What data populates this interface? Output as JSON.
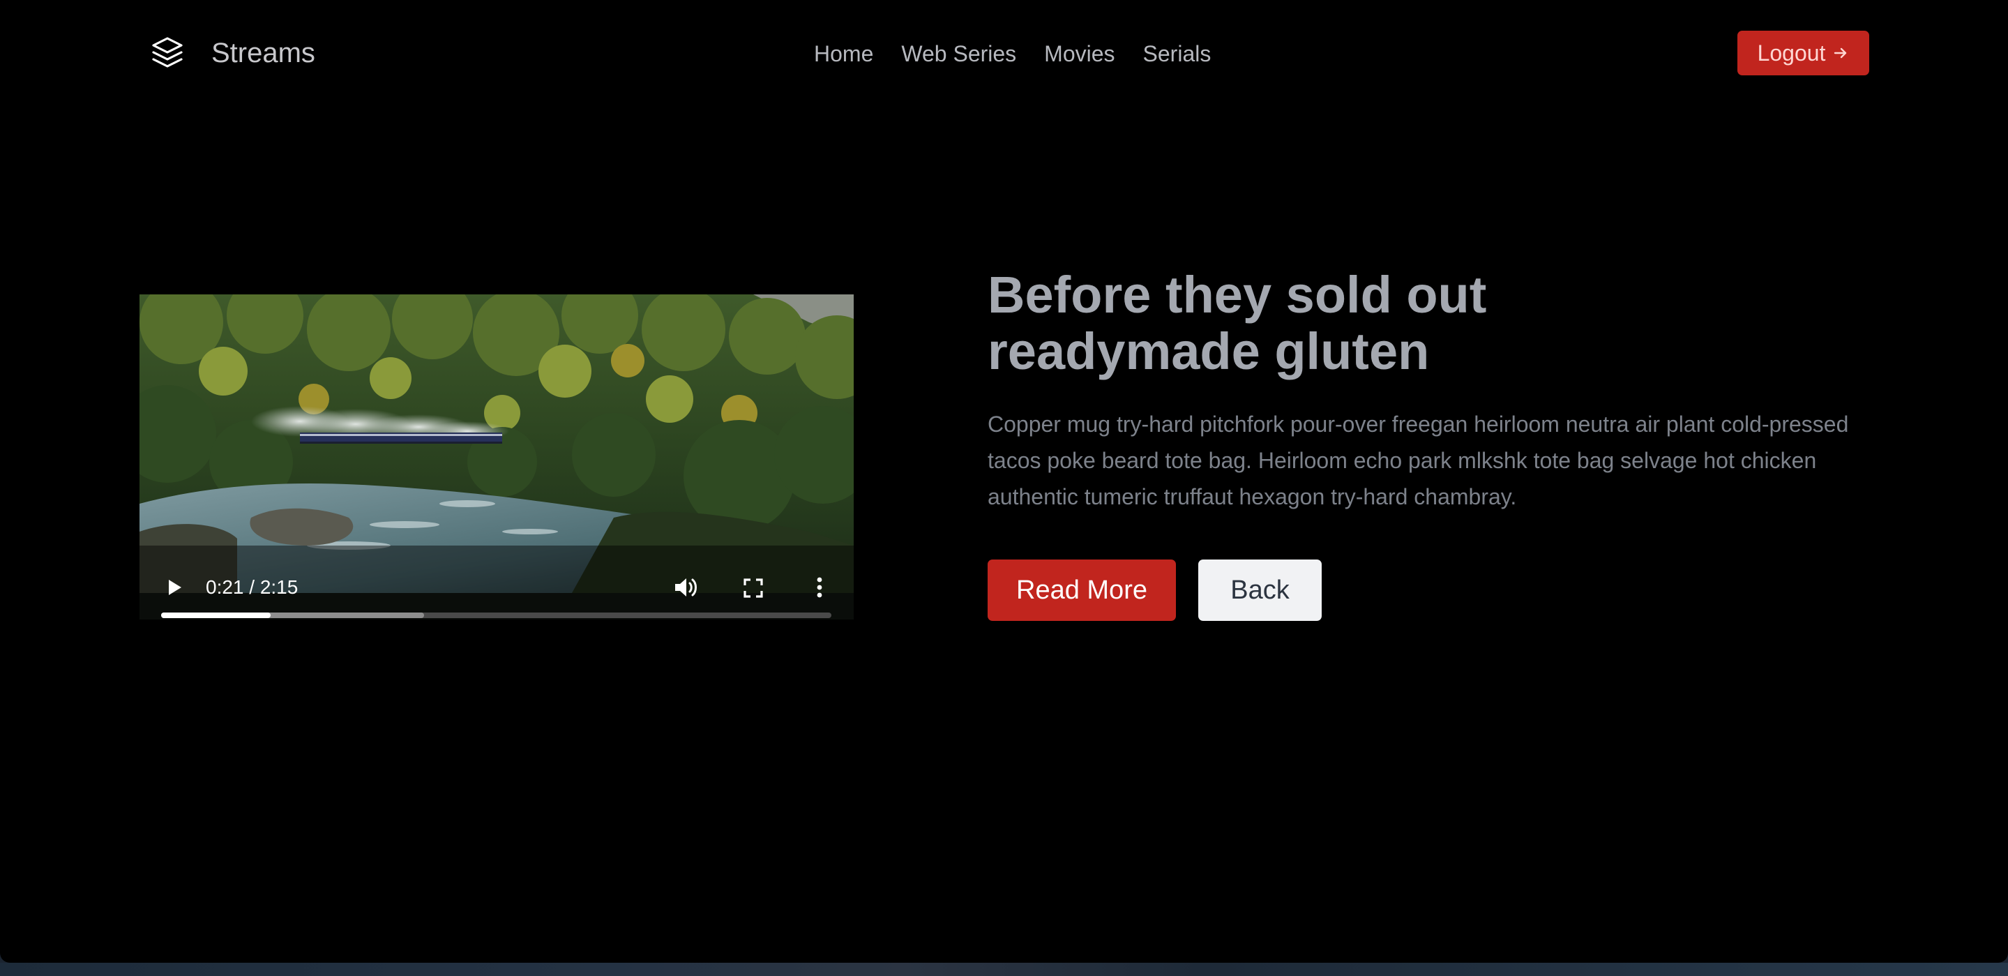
{
  "header": {
    "brand": "Streams",
    "nav": [
      "Home",
      "Web Series",
      "Movies",
      "Serials"
    ],
    "logout_label": "Logout"
  },
  "video": {
    "current_time": "0:21",
    "duration": "2:15",
    "time_display": "0:21 / 2:15",
    "played_fraction": 0.163,
    "buffered_fraction": 0.392
  },
  "hero": {
    "title": "Before they sold out readymade gluten",
    "description": "Copper mug try-hard pitchfork pour-over freegan heirloom neutra air plant cold-pressed tacos poke beard tote bag. Heirloom echo park mlkshk tote bag selvage hot chicken authentic tumeric truffaut hexagon try-hard chambray.",
    "primary_button": "Read More",
    "secondary_button": "Back"
  },
  "icons": {
    "logo": "layers-icon",
    "logout": "arrow-right-icon",
    "play": "play-icon",
    "volume": "volume-icon",
    "fullscreen": "fullscreen-icon",
    "more": "more-vertical-icon"
  },
  "colors": {
    "accent": "#c1251e",
    "background": "#000000",
    "title": "#a4a8b0",
    "body_text": "#7d828b"
  }
}
